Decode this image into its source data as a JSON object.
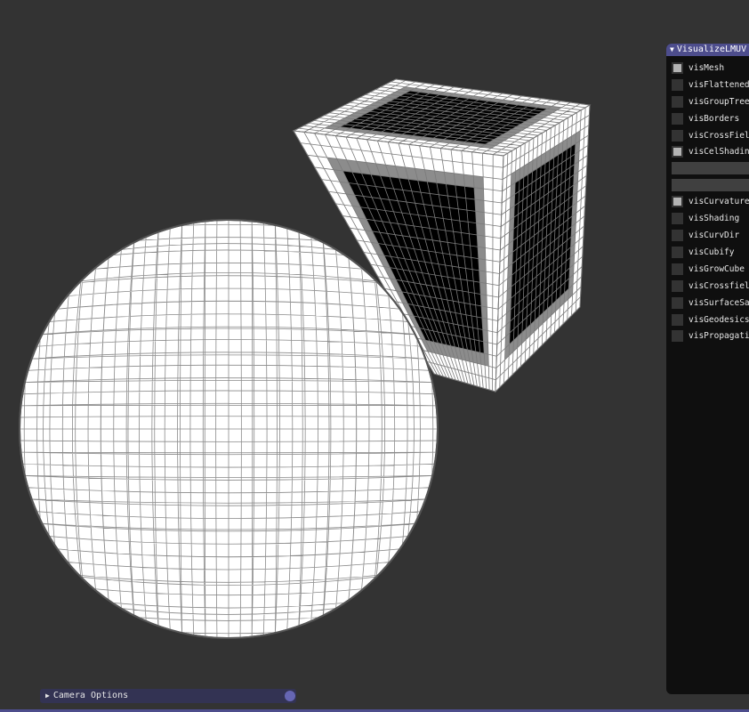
{
  "panel": {
    "title": "VisualizeLMUV",
    "toggles_group1": [
      {
        "label": "visMesh",
        "checked": true
      },
      {
        "label": "visFlattened",
        "checked": false
      },
      {
        "label": "visGroupTree",
        "checked": false
      },
      {
        "label": "visBorders",
        "checked": false
      },
      {
        "label": "visCrossFiel",
        "checked": false
      },
      {
        "label": "visCelShadin",
        "checked": true
      }
    ],
    "toggles_group2": [
      {
        "label": "visCurvature",
        "checked": true
      },
      {
        "label": "visShading",
        "checked": false
      },
      {
        "label": "visCurvDir",
        "checked": false
      },
      {
        "label": "visCubify",
        "checked": false
      },
      {
        "label": "visGrowCube",
        "checked": false
      },
      {
        "label": "visCrossfiel",
        "checked": false
      },
      {
        "label": "visSurfaceSa",
        "checked": false
      },
      {
        "label": "visGeodesics",
        "checked": false
      },
      {
        "label": "visPropagati",
        "checked": false
      }
    ]
  },
  "camera": {
    "label": "Camera Options",
    "expanded": false
  },
  "colors": {
    "background": "#333333",
    "accent": "#4d4d8c",
    "checkbox_mark": "#b3b3b3"
  }
}
